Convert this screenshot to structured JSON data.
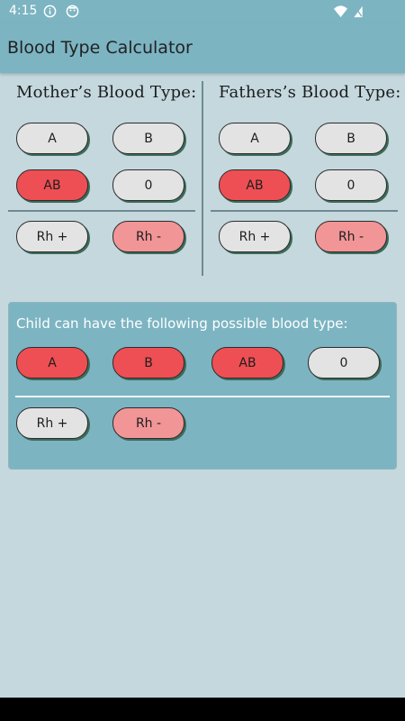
{
  "status": {
    "time": "4:15",
    "icons": [
      "info-circle-icon",
      "face-icon",
      "wifi-icon",
      "battery-icon"
    ]
  },
  "appbar": {
    "title": "Blood Type Calculator"
  },
  "mother": {
    "title": "Mother’s Blood Type:",
    "types": [
      "A",
      "B",
      "AB",
      "0"
    ],
    "selected_type": "AB",
    "rh": [
      "Rh +",
      "Rh -"
    ],
    "selected_rh": "Rh -"
  },
  "father": {
    "title": "Fathers’s Blood Type:",
    "types": [
      "A",
      "B",
      "AB",
      "0"
    ],
    "selected_type": "AB",
    "rh": [
      "Rh +",
      "Rh -"
    ],
    "selected_rh": "Rh -"
  },
  "child": {
    "title": "Child can have the following possible blood type:",
    "types": [
      "A",
      "B",
      "AB",
      "0"
    ],
    "possible_types": [
      "A",
      "B",
      "AB"
    ],
    "rh": [
      "Rh +",
      "Rh -"
    ],
    "possible_rh": [
      "Rh -"
    ]
  },
  "colors": {
    "background": "#c4d8de",
    "appbar": "#7cb4c2",
    "selected_type": "#ee4f54",
    "selected_rh": "#f19597",
    "unselected": "#e3e3e3"
  }
}
